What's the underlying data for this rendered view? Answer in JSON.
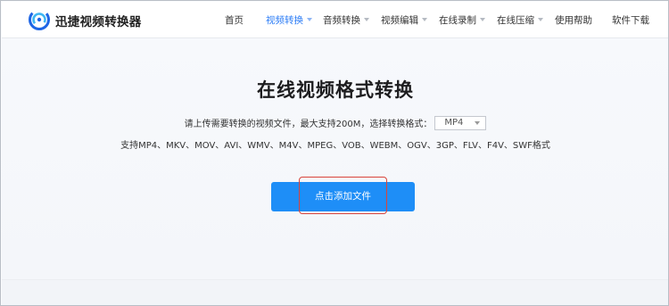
{
  "brand": {
    "name": "迅捷视频转换器",
    "accent": "#2b7cf6"
  },
  "nav": {
    "items": [
      {
        "label": "首页",
        "dropdown": false,
        "active": false
      },
      {
        "label": "视频转换",
        "dropdown": true,
        "active": true
      },
      {
        "label": "音频转换",
        "dropdown": true,
        "active": false
      },
      {
        "label": "视频编辑",
        "dropdown": true,
        "active": false
      },
      {
        "label": "在线录制",
        "dropdown": true,
        "active": false
      },
      {
        "label": "在线压缩",
        "dropdown": true,
        "active": false
      },
      {
        "label": "使用帮助",
        "dropdown": false,
        "active": false
      },
      {
        "label": "软件下载",
        "dropdown": false,
        "active": false
      }
    ]
  },
  "main": {
    "title": "在线视频格式转换",
    "hint": "请上传需要转换的视频文件，最大支持200M，选择转换格式：",
    "format_select": {
      "value": "MP4"
    },
    "supported_formats": "支持MP4、MKV、MOV、AVI、WMV、M4V、MPEG、VOB、WEBM、OGV、3GP、FLV、F4V、SWF格式",
    "add_button_label": "点击添加文件",
    "button_color": "#1e8ef7",
    "highlight_color": "#d9443b"
  }
}
